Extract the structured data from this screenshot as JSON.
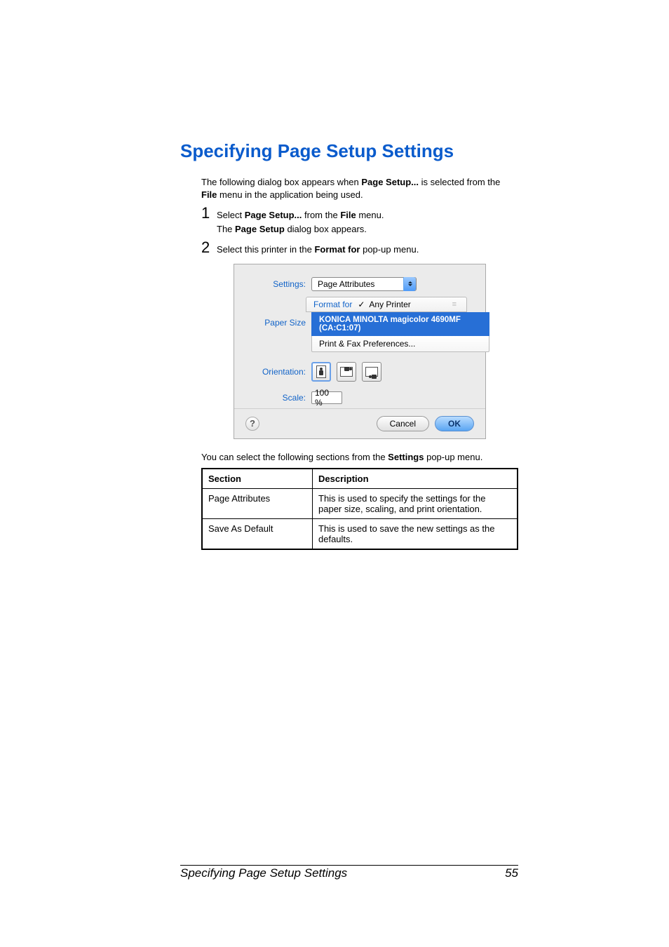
{
  "heading": "Specifying Page Setup Settings",
  "intro": {
    "before_bold": "The following dialog box appears when ",
    "bold1": "Page Setup...",
    "middle": " is selected from the ",
    "bold2": "File",
    "after": " menu in the application being used."
  },
  "step1": {
    "before1": "Select ",
    "bold1": "Page Setup...",
    "mid1": " from the ",
    "bold2": "File",
    "after1": " menu.",
    "line2_before": "The ",
    "line2_bold": "Page Setup",
    "line2_after": " dialog box appears."
  },
  "step2": {
    "before": "Select this printer in the ",
    "bold": "Format for",
    "after": " pop-up menu."
  },
  "dialog": {
    "labels": {
      "settings": "Settings:",
      "format_for": "Format for",
      "paper_size": "Paper Size",
      "orientation": "Orientation:",
      "scale": "Scale:"
    },
    "settings_value": "Page Attributes",
    "format_for_options": {
      "any_printer": "Any Printer",
      "selected": "KONICA MINOLTA magicolor 4690MF (CA:C1:07)",
      "prefs": "Print & Fax Preferences..."
    },
    "scale_value": "100 %",
    "buttons": {
      "help": "?",
      "cancel": "Cancel",
      "ok": "OK"
    }
  },
  "after_dialog": {
    "before": "You can select the following sections from the ",
    "bold": "Settings",
    "after": " pop-up menu."
  },
  "table": {
    "headers": {
      "section": "Section",
      "description": "Description"
    },
    "rows": [
      {
        "section": "Page Attributes",
        "description": "This is used to specify the settings for the paper size, scaling, and print orientation."
      },
      {
        "section": "Save As Default",
        "description": "This is used to save the new settings as the defaults."
      }
    ]
  },
  "footer": {
    "title": "Specifying Page Setup Settings",
    "page": "55"
  },
  "nums": {
    "n1": "1",
    "n2": "2"
  }
}
